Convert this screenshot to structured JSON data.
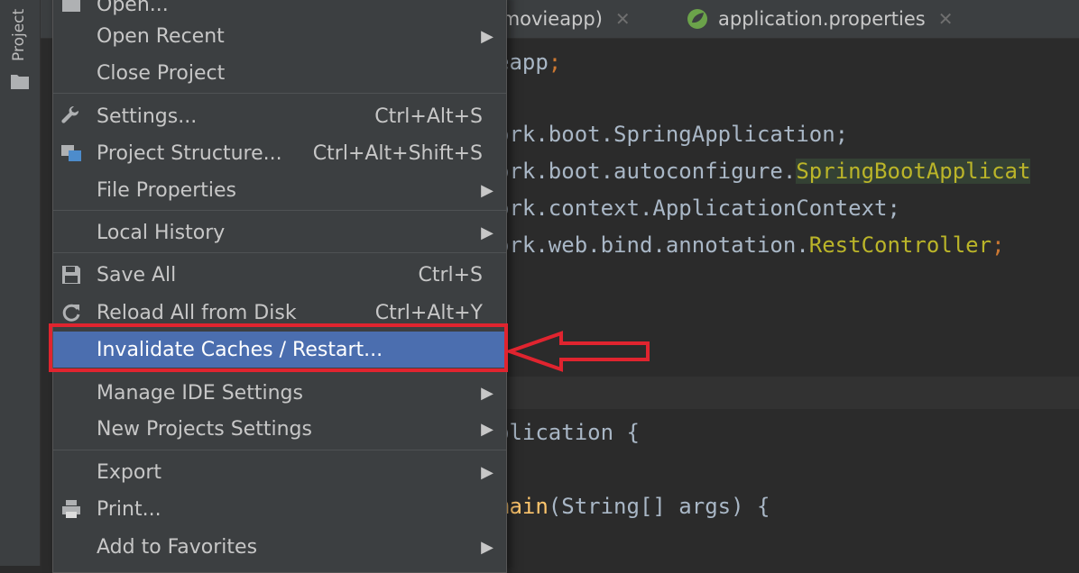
{
  "sidebar": {
    "project_label": "Project"
  },
  "tabs": [
    {
      "label": "l (movieapp)"
    },
    {
      "label": "application.properties"
    }
  ],
  "code_lines": {
    "l1_pre": "eapp",
    "l1_post": ";",
    "l2": "ork.boot.SpringApplication;",
    "l3_pre": "ork.boot.autoconfigure.",
    "l3_hl": "SpringBootApplicat",
    "l4": "ork.context.ApplicationContext;",
    "l5_pre": "ork.web.bind.annotation.",
    "l5_hl": "RestController",
    "l5_post": ";",
    "l6": "plication {",
    "l7_fn": "main",
    "l7_rest": "(String[] args) {"
  },
  "menu": {
    "items": [
      {
        "label": "Open...",
        "shortcut": ""
      },
      {
        "label": "Open Recent",
        "shortcut": ""
      },
      {
        "label": "Close Project",
        "shortcut": ""
      },
      {
        "label": "Settings...",
        "shortcut": "Ctrl+Alt+S"
      },
      {
        "label": "Project Structure...",
        "shortcut": "Ctrl+Alt+Shift+S"
      },
      {
        "label": "File Properties",
        "shortcut": ""
      },
      {
        "label": "Local History",
        "shortcut": ""
      },
      {
        "label": "Save All",
        "shortcut": "Ctrl+S"
      },
      {
        "label": "Reload All from Disk",
        "shortcut": "Ctrl+Alt+Y"
      },
      {
        "label": "Invalidate Caches / Restart...",
        "shortcut": ""
      },
      {
        "label": "Manage IDE Settings",
        "shortcut": ""
      },
      {
        "label": "New Projects Settings",
        "shortcut": ""
      },
      {
        "label": "Export",
        "shortcut": ""
      },
      {
        "label": "Print...",
        "shortcut": ""
      },
      {
        "label": "Add to Favorites",
        "shortcut": ""
      }
    ]
  },
  "colors": {
    "accent_selection": "#4b6eaf",
    "annotation_red": "#e0242f"
  }
}
